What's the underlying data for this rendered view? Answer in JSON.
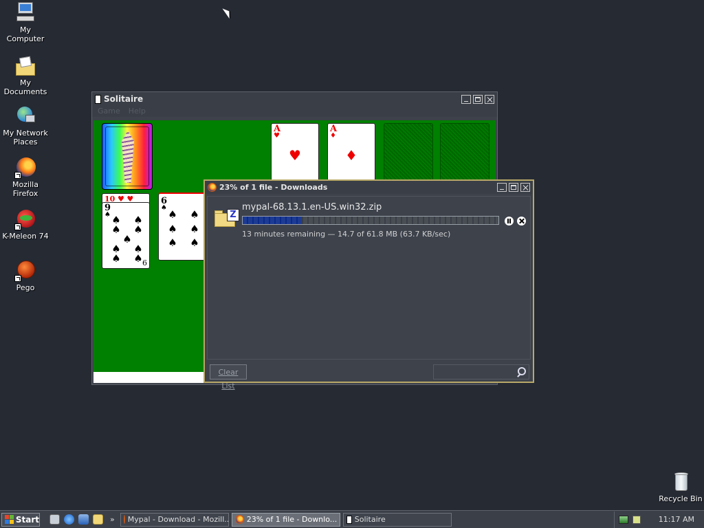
{
  "desktop": {
    "icons": [
      {
        "label": "My Computer"
      },
      {
        "label": "My Documents"
      },
      {
        "label": "My Network Places"
      },
      {
        "label": "Mozilla Firefox"
      },
      {
        "label": "K-Meleon 74"
      },
      {
        "label": "Pego"
      },
      {
        "label": "Recycle Bin"
      }
    ]
  },
  "solitaire": {
    "title": "Solitaire",
    "menu": [
      "Game",
      "Help"
    ],
    "foundations": [
      {
        "rank": "A",
        "suit": "♥",
        "color": "red"
      },
      {
        "rank": "A",
        "suit": "♦",
        "color": "red"
      }
    ],
    "tableau": [
      {
        "top": "10",
        "rank": "9",
        "suit": "♠"
      },
      {
        "rank": "6",
        "suit": "♠"
      }
    ]
  },
  "downloads": {
    "title": "23% of 1 file - Downloads",
    "item": {
      "filename": "mypal-68.13.1.en-US.win32.zip",
      "progress_percent": 23,
      "status": "13 minutes remaining — 14.7 of 61.8 MB (63.7 KB/sec)"
    },
    "clear_label": "Clear List",
    "search_placeholder": ""
  },
  "taskbar": {
    "start_label": "Start",
    "tasks": [
      {
        "label": "Mypal - Download - Mozill..."
      },
      {
        "label": "23% of 1 file - Downlo..."
      },
      {
        "label": "Solitaire"
      }
    ],
    "clock": "11:17 AM"
  },
  "colors": {
    "desktop_bg": "#252a33",
    "felt": "#008000",
    "progress_fill": "#0a2a8a"
  }
}
